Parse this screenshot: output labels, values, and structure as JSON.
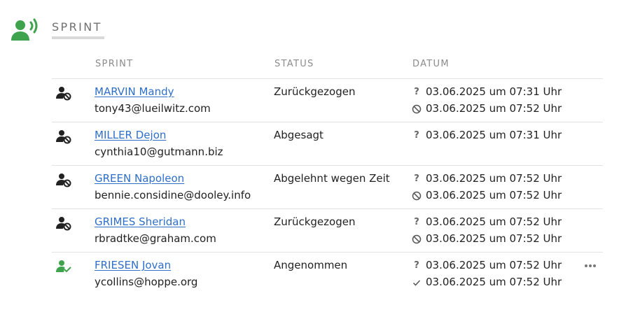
{
  "section": {
    "title": "SPRINT"
  },
  "columns": {
    "sprint": "SPRINT",
    "status": "STATUS",
    "datum": "DATUM"
  },
  "colors": {
    "accent_green": "#3fa34d",
    "link_blue": "#2e6fc9",
    "muted": "#8c8c8c"
  },
  "rows": [
    {
      "icon": "person-blocked-icon",
      "name": "MARVIN Mandy",
      "email": "tony43@lueilwitz.com",
      "status": "Zurückgezogen",
      "dates": [
        {
          "icon": "question-icon",
          "text": "03.06.2025 um 07:31 Uhr"
        },
        {
          "icon": "blocked-circle-icon",
          "text": "03.06.2025 um 07:52 Uhr"
        }
      ]
    },
    {
      "icon": "person-blocked-icon",
      "name": "MILLER Dejon",
      "email": "cynthia10@gutmann.biz",
      "status": "Abgesagt",
      "dates": [
        {
          "icon": "question-icon",
          "text": "03.06.2025 um 07:31 Uhr"
        }
      ]
    },
    {
      "icon": "person-blocked-icon",
      "name": "GREEN Napoleon",
      "email": "bennie.considine@dooley.info",
      "status": "Abgelehnt wegen Zeit",
      "dates": [
        {
          "icon": "question-icon",
          "text": "03.06.2025 um 07:52 Uhr"
        },
        {
          "icon": "blocked-circle-icon",
          "text": "03.06.2025 um 07:52 Uhr"
        }
      ]
    },
    {
      "icon": "person-blocked-icon",
      "name": "GRIMES Sheridan",
      "email": "rbradtke@graham.com",
      "status": "Zurückgezogen",
      "dates": [
        {
          "icon": "question-icon",
          "text": "03.06.2025 um 07:52 Uhr"
        },
        {
          "icon": "blocked-circle-icon",
          "text": "03.06.2025 um 07:52 Uhr"
        }
      ]
    },
    {
      "icon": "person-check-icon",
      "name": "FRIESEN Jovan",
      "email": "ycollins@hoppe.org",
      "status": "Angenommen",
      "dates": [
        {
          "icon": "question-icon",
          "text": "03.06.2025 um 07:52 Uhr"
        },
        {
          "icon": "check-icon",
          "text": "03.06.2025 um 07:52 Uhr"
        }
      ]
    }
  ]
}
